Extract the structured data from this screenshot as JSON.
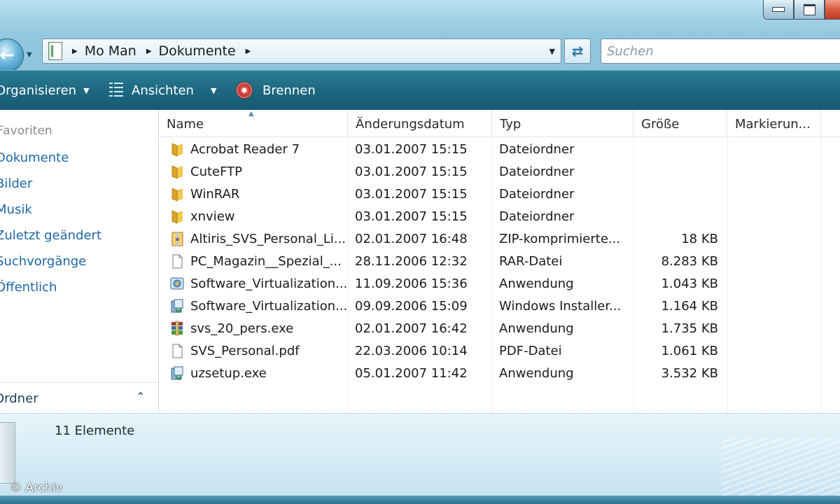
{
  "window": {
    "controls": [
      "minimize",
      "maximize",
      "close"
    ]
  },
  "address": {
    "breadcrumbs": [
      "Mo Man",
      "Dokumente"
    ],
    "search_placeholder": "Suchen"
  },
  "toolbar": {
    "organize": "Organisieren",
    "views": "Ansichten",
    "burn": "Brennen"
  },
  "nav": {
    "heading": "Favoriten",
    "items": [
      "Dokumente",
      "Bilder",
      "Musik",
      "Zuletzt geändert",
      "Suchvorgänge",
      "Öffentlich"
    ],
    "folders_label": "Ordner"
  },
  "columns": [
    "Name",
    "Änderungsdatum",
    "Typ",
    "Größe",
    "Markierun..."
  ],
  "files": [
    {
      "name": "Acrobat Reader 7",
      "date": "03.01.2007 15:15",
      "type": "Dateiordner",
      "size": "",
      "icon": "folder-icon"
    },
    {
      "name": "CuteFTP",
      "date": "03.01.2007 15:15",
      "type": "Dateiordner",
      "size": "",
      "icon": "folder-icon"
    },
    {
      "name": "WinRAR",
      "date": "03.01.2007 15:15",
      "type": "Dateiordner",
      "size": "",
      "icon": "folder-icon"
    },
    {
      "name": "xnview",
      "date": "03.01.2007 15:15",
      "type": "Dateiordner",
      "size": "",
      "icon": "folder-icon"
    },
    {
      "name": "Altiris_SVS_Personal_Li...",
      "date": "02.01.2007 16:48",
      "type": "ZIP-komprimierte...",
      "size": "18 KB",
      "icon": "zip-icon"
    },
    {
      "name": "PC_Magazin__Spezial_...",
      "date": "28.11.2006 12:32",
      "type": "RAR-Datei",
      "size": "8.283 KB",
      "icon": "document-icon"
    },
    {
      "name": "Software_Virtualization...",
      "date": "11.09.2006 15:36",
      "type": "Anwendung",
      "size": "1.043 KB",
      "icon": "application-icon"
    },
    {
      "name": "Software_Virtualization...",
      "date": "09.09.2006 15:09",
      "type": "Windows Installer...",
      "size": "1.164 KB",
      "icon": "installer-icon"
    },
    {
      "name": "svs_20_pers.exe",
      "date": "02.01.2007 16:42",
      "type": "Anwendung",
      "size": "1.735 KB",
      "icon": "winrar-archive-icon"
    },
    {
      "name": "SVS_Personal.pdf",
      "date": "22.03.2006 10:14",
      "type": "PDF-Datei",
      "size": "1.061 KB",
      "icon": "document-icon"
    },
    {
      "name": "uzsetup.exe",
      "date": "05.01.2007 11:42",
      "type": "Anwendung",
      "size": "3.532 KB",
      "icon": "installer-icon"
    }
  ],
  "details": {
    "count": "11 Elemente"
  },
  "credit": "© Archiv"
}
